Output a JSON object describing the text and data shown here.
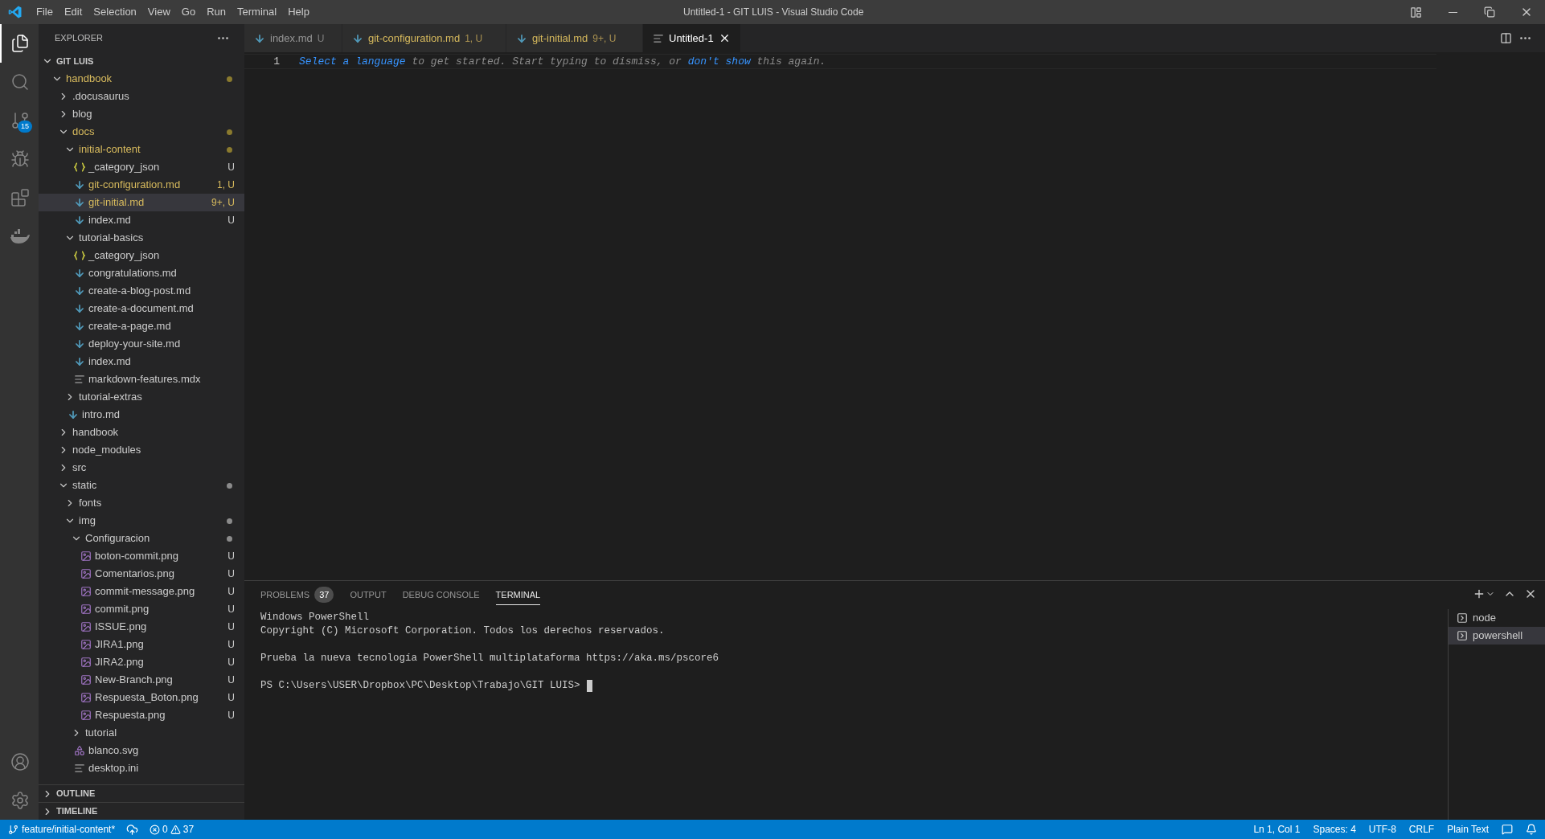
{
  "window": {
    "title": "Untitled-1 - GIT LUIS - Visual Studio Code"
  },
  "menu": [
    "File",
    "Edit",
    "Selection",
    "View",
    "Go",
    "Run",
    "Terminal",
    "Help"
  ],
  "activity_bar": {
    "items": [
      {
        "kind": "explorer",
        "selected": true
      },
      {
        "kind": "search",
        "selected": false
      },
      {
        "kind": "source_control",
        "selected": false,
        "badge": "15"
      },
      {
        "kind": "run",
        "selected": false
      },
      {
        "kind": "extensions",
        "selected": false
      },
      {
        "kind": "docker",
        "selected": false
      }
    ],
    "bottom_items": [
      {
        "kind": "account"
      },
      {
        "kind": "settings"
      }
    ]
  },
  "sidebar": {
    "title": "EXPLORER",
    "root": {
      "label": "GIT LUIS",
      "expanded": true
    },
    "tree": [
      {
        "label": "handbook",
        "kind": "folder",
        "expanded": true,
        "modified": true,
        "color": "#8a7a2e",
        "selected": false,
        "children": [
          {
            "label": ".docusaurus",
            "kind": "folder",
            "expanded": false,
            "modified": false,
            "selected": false
          },
          {
            "label": "blog",
            "kind": "folder",
            "expanded": false,
            "modified": false,
            "selected": false
          },
          {
            "label": "docs",
            "kind": "folder",
            "expanded": true,
            "modified": true,
            "color": "#8a7a2e",
            "selected": false,
            "children": [
              {
                "label": "initial-content",
                "kind": "folder",
                "expanded": true,
                "modified": true,
                "color": "#8a7a2e",
                "selected": false,
                "children": [
                  {
                    "label": "_category_json",
                    "kind": "json",
                    "modified": false,
                    "decoration": "U",
                    "selected": false
                  },
                  {
                    "label": "git-configuration.md",
                    "kind": "markdown",
                    "modified": true,
                    "decoration": "1, U",
                    "selected": false
                  },
                  {
                    "label": "git-initial.md",
                    "kind": "markdown",
                    "modified": true,
                    "decoration": "9+, U",
                    "selected": true
                  },
                  {
                    "label": "index.md",
                    "kind": "markdown",
                    "modified": false,
                    "decoration": "U",
                    "selected": false
                  }
                ]
              },
              {
                "label": "tutorial-basics",
                "kind": "folder",
                "expanded": true,
                "modified": false,
                "selected": false,
                "children": [
                  {
                    "label": "_category_json",
                    "kind": "json",
                    "modified": false,
                    "selected": false
                  },
                  {
                    "label": "congratulations.md",
                    "kind": "markdown",
                    "modified": false,
                    "selected": false
                  },
                  {
                    "label": "create-a-blog-post.md",
                    "kind": "markdown",
                    "modified": false,
                    "selected": false
                  },
                  {
                    "label": "create-a-document.md",
                    "kind": "markdown",
                    "modified": false,
                    "selected": false
                  },
                  {
                    "label": "create-a-page.md",
                    "kind": "markdown",
                    "modified": false,
                    "selected": false
                  },
                  {
                    "label": "deploy-your-site.md",
                    "kind": "markdown",
                    "modified": false,
                    "selected": false
                  },
                  {
                    "label": "index.md",
                    "kind": "markdown",
                    "modified": false,
                    "selected": false
                  },
                  {
                    "label": "markdown-features.mdx",
                    "kind": "text",
                    "modified": false,
                    "selected": false
                  }
                ]
              },
              {
                "label": "tutorial-extras",
                "kind": "folder",
                "expanded": false,
                "modified": false,
                "selected": false
              },
              {
                "label": "intro.md",
                "kind": "markdown",
                "modified": false,
                "selected": false
              }
            ]
          },
          {
            "label": "handbook",
            "kind": "folder",
            "expanded": false,
            "modified": false,
            "selected": false
          },
          {
            "label": "node_modules",
            "kind": "folder",
            "expanded": false,
            "modified": false,
            "selected": false
          },
          {
            "label": "src",
            "kind": "folder",
            "expanded": false,
            "modified": false,
            "selected": false
          },
          {
            "label": "static",
            "kind": "folder",
            "expanded": true,
            "modified": false,
            "color": "#8b8b8b",
            "selected": false,
            "children": [
              {
                "label": "fonts",
                "kind": "folder",
                "expanded": false,
                "modified": false,
                "selected": false
              },
              {
                "label": "img",
                "kind": "folder",
                "expanded": true,
                "modified": false,
                "color": "#8b8b8b",
                "selected": false,
                "children": [
                  {
                    "label": "Configuracion",
                    "kind": "folder",
                    "expanded": true,
                    "modified": false,
                    "color": "#8b8b8b",
                    "selected": false,
                    "children": [
                      {
                        "label": "boton-commit.png",
                        "kind": "image",
                        "modified": false,
                        "decoration": "U",
                        "selected": false
                      },
                      {
                        "label": "Comentarios.png",
                        "kind": "image",
                        "modified": false,
                        "decoration": "U",
                        "selected": false
                      },
                      {
                        "label": "commit-message.png",
                        "kind": "image",
                        "modified": false,
                        "decoration": "U",
                        "selected": false
                      },
                      {
                        "label": "commit.png",
                        "kind": "image",
                        "modified": false,
                        "decoration": "U",
                        "selected": false
                      },
                      {
                        "label": "ISSUE.png",
                        "kind": "image",
                        "modified": false,
                        "decoration": "U",
                        "selected": false
                      },
                      {
                        "label": "JIRA1.png",
                        "kind": "image",
                        "modified": false,
                        "decoration": "U",
                        "selected": false
                      },
                      {
                        "label": "JIRA2.png",
                        "kind": "image",
                        "modified": false,
                        "decoration": "U",
                        "selected": false
                      },
                      {
                        "label": "New-Branch.png",
                        "kind": "image",
                        "modified": false,
                        "decoration": "U",
                        "selected": false
                      },
                      {
                        "label": "Respuesta_Boton.png",
                        "kind": "image",
                        "modified": false,
                        "decoration": "U",
                        "selected": false
                      },
                      {
                        "label": "Respuesta.png",
                        "kind": "image",
                        "modified": false,
                        "decoration": "U",
                        "selected": false
                      }
                    ]
                  },
                  {
                    "label": "tutorial",
                    "kind": "folder",
                    "expanded": false,
                    "modified": false,
                    "selected": false
                  },
                  {
                    "label": "blanco.svg",
                    "kind": "svg",
                    "modified": false,
                    "selected": false
                  },
                  {
                    "label": "desktop.ini",
                    "kind": "text",
                    "modified": false,
                    "selected": false
                  }
                ]
              }
            ]
          }
        ]
      }
    ],
    "sections": [
      {
        "label": "OUTLINE",
        "expanded": false
      },
      {
        "label": "TIMELINE",
        "expanded": false
      }
    ]
  },
  "editor": {
    "tabs": [
      {
        "label": "index.md",
        "badge": "U",
        "kind": "markdown",
        "modified": false,
        "selected": false
      },
      {
        "label": "git-configuration.md",
        "badge": "1, U",
        "kind": "markdown",
        "modified": true,
        "selected": false
      },
      {
        "label": "git-initial.md",
        "badge": "9+, U",
        "kind": "markdown",
        "modified": true,
        "selected": false
      },
      {
        "label": "Untitled-1",
        "kind": "text",
        "modified": false,
        "selected": true
      }
    ],
    "lines": [
      {
        "number": "1",
        "segments": [
          {
            "kind": "link",
            "text": "Select a language"
          },
          {
            "kind": "text",
            "text": "to get started. Start typing to dismiss, or"
          },
          {
            "kind": "link",
            "text": "don't show"
          },
          {
            "kind": "text",
            "text": "this again."
          }
        ]
      }
    ]
  },
  "panel": {
    "tabs": [
      {
        "label": "PROBLEMS",
        "badge": "37",
        "selected": false
      },
      {
        "label": "OUTPUT",
        "selected": false
      },
      {
        "label": "DEBUG CONSOLE",
        "selected": false
      },
      {
        "label": "TERMINAL",
        "selected": true
      }
    ],
    "terminal": {
      "blocks": [
        [
          "Windows PowerShell",
          "Copyright (C) Microsoft Corporation. Todos los derechos reservados."
        ],
        [
          "Prueba la nueva tecnología PowerShell multiplataforma https://aka.ms/pscore6"
        ],
        [
          "PS C:\\Users\\USER\\Dropbox\\PC\\Desktop\\Trabajo\\GIT LUIS>"
        ]
      ],
      "cursor": true
    },
    "terminals": [
      {
        "label": "node",
        "selected": false
      },
      {
        "label": "powershell",
        "selected": true
      }
    ]
  },
  "status_bar": {
    "branch": "feature/initial-content*",
    "errors": "0",
    "warnings": "37",
    "items": [
      "Ln 1, Col 1",
      "Spaces: 4",
      "UTF-8",
      "CRLF",
      "Plain Text"
    ]
  }
}
